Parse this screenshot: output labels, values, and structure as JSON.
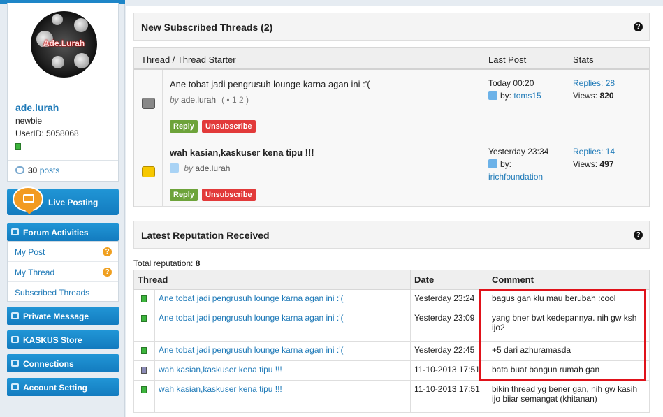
{
  "sidebar": {
    "avatar_text": "Ade.Lurah",
    "username": "ade.lurah",
    "rank": "newbie",
    "user_id": "UserID: 5058068",
    "posts_count": "30",
    "posts_label": "posts",
    "live_posting": "Live Posting",
    "forum_activities": "Forum Activities",
    "menu": [
      {
        "label": "My Post",
        "badge": "?"
      },
      {
        "label": "My Thread",
        "badge": "?"
      },
      {
        "label": "Subscribed Threads"
      }
    ],
    "private_message": "Private Message",
    "store": "KASKUS Store",
    "connections": "Connections",
    "account_setting": "Account Setting"
  },
  "subscribed": {
    "title": "New Subscribed Threads (2)",
    "help": "?",
    "col_thread": "Thread / Thread Starter",
    "col_last": "Last Post",
    "col_stats": "Stats",
    "threads": [
      {
        "title": "Ane tobat jadi pengrusuh lounge karna agan ini :'(",
        "by": "by",
        "starter": "ade.lurah",
        "pages": "1   2 )",
        "pages_open": "(",
        "reply": "Reply",
        "unsubscribe": "Unsubscribe",
        "last_time": "Today 00:20",
        "last_by": "by:",
        "last_user": "toms15",
        "replies": "Replies: 28",
        "views_label": "Views:",
        "views": "820"
      },
      {
        "title": "wah kasian,kaskuser kena tipu !!!",
        "by": "by",
        "starter": "ade.lurah",
        "reply": "Reply",
        "unsubscribe": "Unsubscribe",
        "last_time": "Yesterday 23:34",
        "last_by": "by:",
        "last_user": "irichfoundation",
        "replies": "Replies: 14",
        "views_label": "Views:",
        "views": "497"
      }
    ]
  },
  "reputation": {
    "title": "Latest Reputation Received",
    "help": "?",
    "total_label": "Total reputation:",
    "total": "8",
    "col_thread": "Thread",
    "col_date": "Date",
    "col_comment": "Comment",
    "rows": [
      {
        "thread": "Ane tobat jadi pengrusuh lounge karna agan ini :'(",
        "date": "Yesterday 23:24",
        "comment": "bagus gan klu mau berubah :cool"
      },
      {
        "thread": "Ane tobat jadi pengrusuh lounge karna agan ini :'(",
        "date": "Yesterday 23:09",
        "comment": "yang bner bwt kedepannya. nih gw ksh ijo2"
      },
      {
        "thread": "Ane tobat jadi pengrusuh lounge karna agan ini :'(",
        "date": "Yesterday 22:45",
        "comment": "+5 dari azhuramasda"
      },
      {
        "thread": "wah kasian,kaskuser kena tipu !!!",
        "date": "11-10-2013 17:51",
        "comment": "bata buat bangun rumah gan"
      },
      {
        "thread": "wah kasian,kaskuser kena tipu !!!",
        "date": "11-10-2013 17:51",
        "comment": "bikin thread yg bener gan, nih gw kasih ijo biiar semangat (khitanan)"
      }
    ]
  },
  "colors": {
    "accent": "#1e86c8",
    "reply": "#6da33a",
    "unsubscribe": "#e23a3a",
    "highlight": "#e0121a"
  }
}
